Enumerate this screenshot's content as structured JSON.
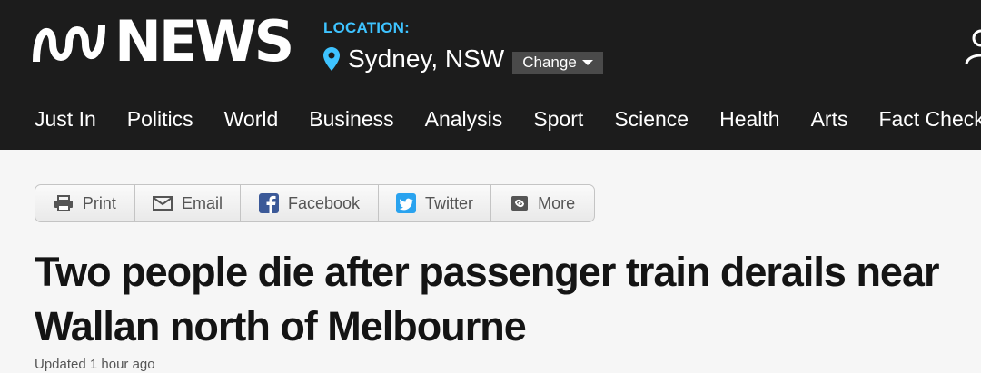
{
  "header": {
    "logo_text": "NEWS",
    "location_label": "LOCATION:",
    "location_city": "Sydney, NSW",
    "change_label": "Change",
    "accent_color": "#3ec3ff",
    "background_color": "#1c1c1c"
  },
  "nav": {
    "items": [
      "Just In",
      "Politics",
      "World",
      "Business",
      "Analysis",
      "Sport",
      "Science",
      "Health",
      "Arts",
      "Fact Check"
    ]
  },
  "share": {
    "print": "Print",
    "email": "Email",
    "facebook": "Facebook",
    "twitter": "Twitter",
    "more": "More"
  },
  "article": {
    "headline": "Two people die after passenger train derails near Wallan north of Melbourne",
    "updated": "Updated 1 hour ago"
  }
}
